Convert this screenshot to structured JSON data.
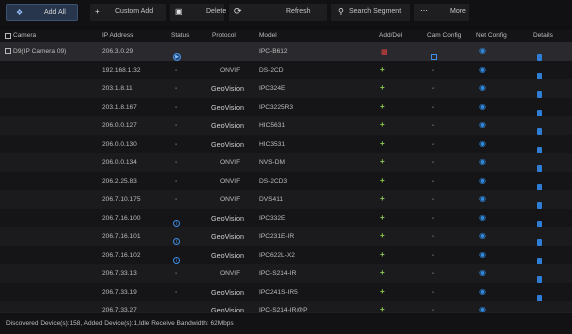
{
  "toolbar": {
    "add_all": "Add All",
    "custom_add": "Custom Add",
    "delete": "Delete",
    "refresh": "Refresh",
    "search_segment": "Search Segment",
    "more": "More",
    "icons": {
      "add_all": "plus-diamond-icon",
      "custom_add": "plus-icon",
      "delete": "trash-icon",
      "refresh": "refresh-icon",
      "search": "search-icon",
      "more": "ellipsis-icon"
    }
  },
  "columns": {
    "camera": "Camera",
    "ip": "IP Address",
    "status": "Status",
    "protocol": "Protocol",
    "model": "Model",
    "adddel": "Add/Del",
    "camcfg": "Cam Config",
    "netcfg": "Net Config",
    "details": "Details"
  },
  "rows": [
    {
      "camera": "D9(IP Camera 09)",
      "ip": "206.3.0.29",
      "status": "play",
      "protocol": "",
      "model": "IPC-B612",
      "action": "delete",
      "camcfg": "edit"
    },
    {
      "camera": "",
      "ip": "192.168.1.32",
      "status": "-",
      "protocol": "ONVIF",
      "model": "DS-2CD",
      "action": "add",
      "camcfg": "-"
    },
    {
      "camera": "",
      "ip": "203.1.8.11",
      "status": "-",
      "protocol": "GeoVision",
      "model": "IPC324E",
      "action": "add",
      "camcfg": "-"
    },
    {
      "camera": "",
      "ip": "203.1.8.167",
      "status": "-",
      "protocol": "GeoVision",
      "model": "IPC3225R3",
      "action": "add",
      "camcfg": "-"
    },
    {
      "camera": "",
      "ip": "206.0.0.127",
      "status": "-",
      "protocol": "GeoVision",
      "model": "HIC5631",
      "action": "add",
      "camcfg": "-"
    },
    {
      "camera": "",
      "ip": "206.0.0.130",
      "status": "-",
      "protocol": "GeoVision",
      "model": "HIC3531",
      "action": "add",
      "camcfg": "-"
    },
    {
      "camera": "",
      "ip": "206.0.0.134",
      "status": "-",
      "protocol": "ONVIF",
      "model": "NVS-DM",
      "action": "add",
      "camcfg": "-"
    },
    {
      "camera": "",
      "ip": "206.2.25.83",
      "status": "-",
      "protocol": "ONVIF",
      "model": "DS-2CD3",
      "action": "add",
      "camcfg": "-"
    },
    {
      "camera": "",
      "ip": "206.7.10.175",
      "status": "-",
      "protocol": "ONVIF",
      "model": "DVS411",
      "action": "add",
      "camcfg": "-"
    },
    {
      "camera": "",
      "ip": "206.7.16.100",
      "status": "info",
      "protocol": "GeoVision",
      "model": "IPC332E",
      "action": "add",
      "camcfg": "-"
    },
    {
      "camera": "",
      "ip": "206.7.16.101",
      "status": "info",
      "protocol": "GeoVision",
      "model": "IPC231E-IR",
      "action": "add",
      "camcfg": "-"
    },
    {
      "camera": "",
      "ip": "206.7.16.102",
      "status": "info",
      "protocol": "GeoVision",
      "model": "IPC622L-X2",
      "action": "add",
      "camcfg": "-"
    },
    {
      "camera": "",
      "ip": "206.7.33.13",
      "status": "-",
      "protocol": "ONVIF",
      "model": "IPC-S214-IR",
      "action": "add",
      "camcfg": "-"
    },
    {
      "camera": "",
      "ip": "206.7.33.19",
      "status": "-",
      "protocol": "GeoVision",
      "model": "IPC241S-IR5",
      "action": "add",
      "camcfg": "-"
    },
    {
      "camera": "",
      "ip": "206.7.33.27",
      "status": "info",
      "protocol": "GeoVision",
      "model": "IPC-S214-IR@P",
      "action": "add",
      "camcfg": "-"
    }
  ],
  "footer": {
    "text": "Discovered Device(s):158, Added Device(s):1,Idle Receive Bandwidth: 62Mbps"
  },
  "colors": {
    "accent": "#2f8ae0",
    "add": "#8bd04a",
    "delete": "#e04040",
    "background": "#101012"
  }
}
